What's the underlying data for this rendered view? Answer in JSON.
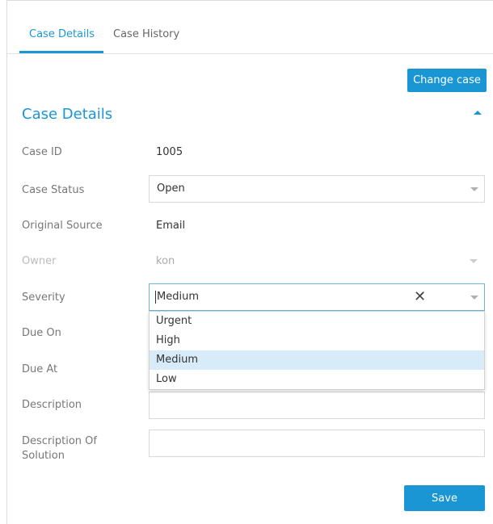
{
  "tabs": [
    {
      "label": "Case Details",
      "active": true
    },
    {
      "label": "Case History",
      "active": false
    }
  ],
  "toolbar": {
    "change_case_label": "Change case"
  },
  "section": {
    "title": "Case Details"
  },
  "fields": {
    "case_id": {
      "label": "Case ID",
      "value": "1005"
    },
    "case_status": {
      "label": "Case Status",
      "value": "Open"
    },
    "original_source": {
      "label": "Original Source",
      "value": "Email"
    },
    "owner": {
      "label": "Owner",
      "value": "kon"
    },
    "severity": {
      "label": "Severity",
      "value": "Medium"
    },
    "due_on": {
      "label": "Due On"
    },
    "due_at": {
      "label": "Due At"
    },
    "description": {
      "label": "Description",
      "value": ""
    },
    "description_of_solution": {
      "label_line1": "Description Of",
      "label_line2": "Solution",
      "value": ""
    }
  },
  "severity_options": [
    {
      "label": "Urgent",
      "selected": false
    },
    {
      "label": "High",
      "selected": false
    },
    {
      "label": "Medium",
      "selected": true
    },
    {
      "label": "Low",
      "selected": false
    }
  ],
  "actions": {
    "save_label": "Save"
  },
  "colors": {
    "accent": "#1a96d4",
    "selected_option_bg": "#d7ecf8"
  }
}
